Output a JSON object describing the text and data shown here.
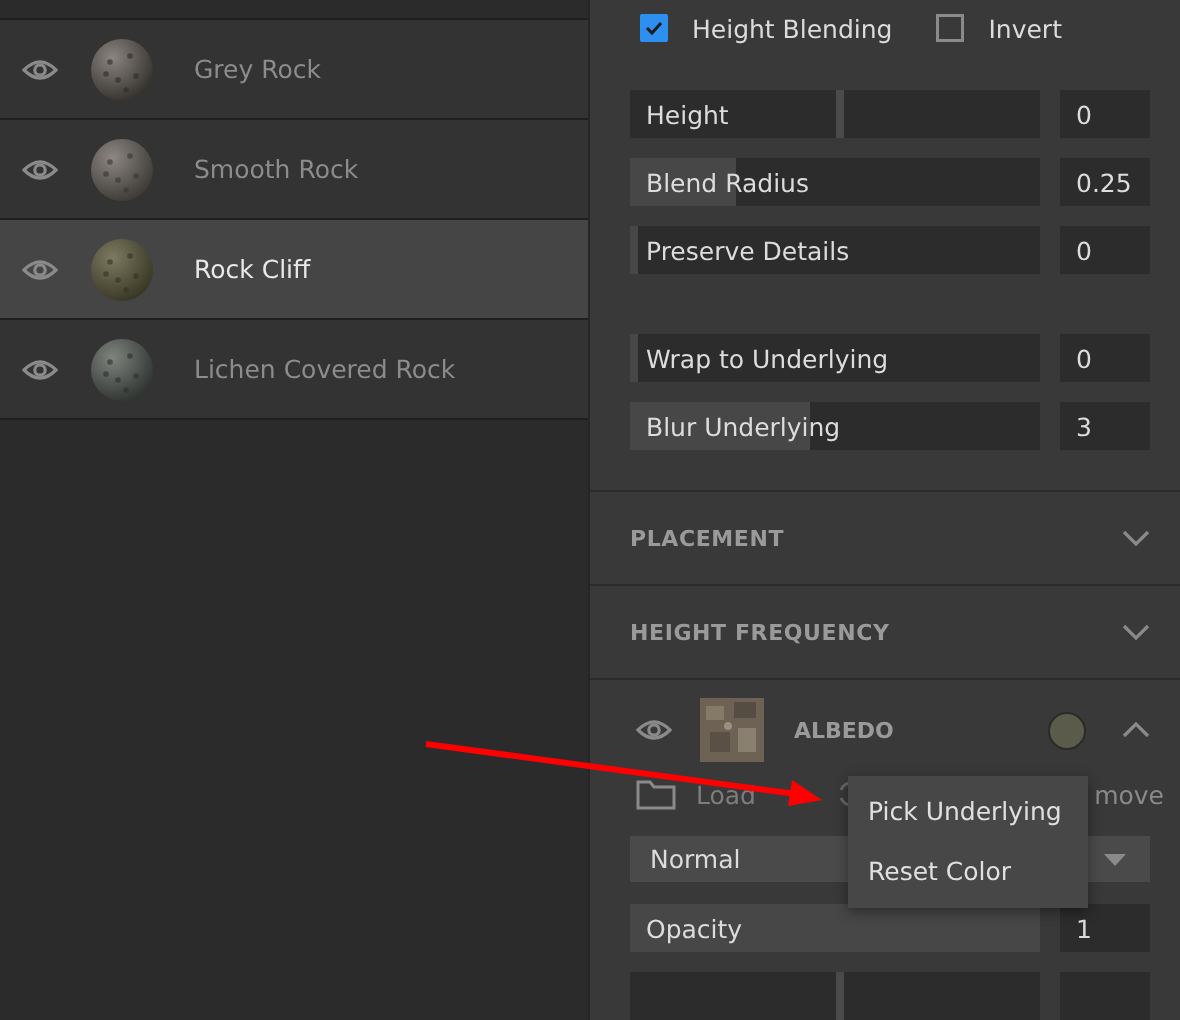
{
  "layers": [
    {
      "name": "Grey Rock",
      "selected": false
    },
    {
      "name": "Smooth Rock",
      "selected": false
    },
    {
      "name": "Rock Cliff",
      "selected": true
    },
    {
      "name": "Lichen Covered Rock",
      "selected": false
    }
  ],
  "blending": {
    "options": [
      {
        "label": "Height Blending",
        "checked": true
      },
      {
        "label": "Invert",
        "checked": false
      }
    ]
  },
  "slider_groups": [
    [
      {
        "kind": "centered",
        "label": "Height",
        "value": "0",
        "level": 0.5
      },
      {
        "kind": "fill",
        "label": "Blend Radius",
        "value": "0.25",
        "level": 0.26
      },
      {
        "kind": "fill",
        "label": "Preserve Details",
        "value": "0",
        "level": 0.02
      }
    ],
    [
      {
        "kind": "fill",
        "label": "Wrap to Underlying",
        "value": "0",
        "level": 0.02
      },
      {
        "kind": "fill",
        "label": "Blur Underlying",
        "value": "3",
        "level": 0.44
      }
    ]
  ],
  "sections": [
    {
      "title": "PLACEMENT",
      "expanded": false
    },
    {
      "title": "HEIGHT FREQUENCY",
      "expanded": false
    }
  ],
  "albedo": {
    "title": "ALBEDO",
    "expanded": true,
    "color": "#5b5b4b",
    "actions": [
      {
        "kind": "load",
        "label": "Load"
      },
      {
        "kind": "refresh"
      },
      {
        "kind": "remove",
        "label": "move"
      }
    ],
    "blend_mode": "Normal",
    "sliders": [
      {
        "kind": "fill",
        "label": "Opacity",
        "value": "1",
        "level": 1
      },
      {
        "kind": "centered",
        "level": 0.5
      }
    ]
  },
  "context_menu": {
    "items": [
      "Pick Underlying",
      "Reset Color"
    ]
  }
}
